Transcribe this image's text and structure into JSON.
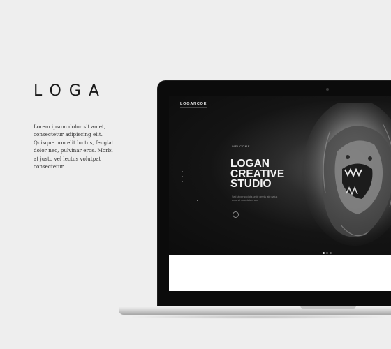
{
  "brand": {
    "title": "LOGA"
  },
  "description": {
    "lines": [
      "Lorem ipsum dolor sit amet,",
      "consectetur adipiscing elit.",
      "Quisque non elit luctus, feugiat",
      "dolor nec, pulvinar eros. Morbi",
      "at justo vel lectus volutpat",
      "consectetur."
    ]
  },
  "screen": {
    "site_logo": "LOGANCOE",
    "welcome": "WELCOME",
    "headline": [
      "LOGAN",
      "CREATIVE",
      "STUDIO"
    ],
    "subline": [
      "Sed ut perspiciatis unde omnis iste natus",
      "error sit voluptatem acc"
    ],
    "pager_active": 1,
    "pager_count": 3
  },
  "colors": {
    "background": "#eeeeee",
    "laptop_frame": "#0b0b0b",
    "hero_text": "#f4f4f4"
  }
}
